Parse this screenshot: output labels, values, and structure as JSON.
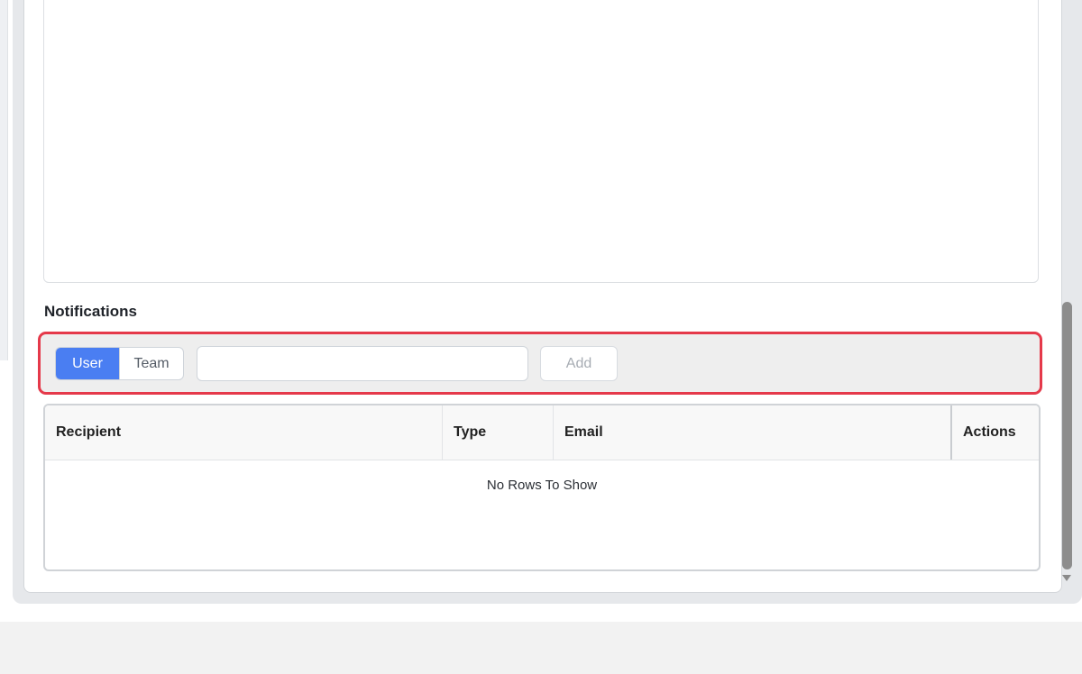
{
  "notifications": {
    "title": "Notifications",
    "toggle": {
      "user_label": "User",
      "team_label": "Team",
      "selected": "User"
    },
    "recipient_input": {
      "value": "",
      "placeholder": ""
    },
    "add_label": "Add"
  },
  "table": {
    "columns": [
      "Recipient",
      "Type",
      "Email",
      "Actions"
    ],
    "rows": [],
    "empty_message": "No Rows To Show"
  },
  "colors": {
    "accent": "#4a7ef2",
    "highlight_border": "#e5394a"
  }
}
